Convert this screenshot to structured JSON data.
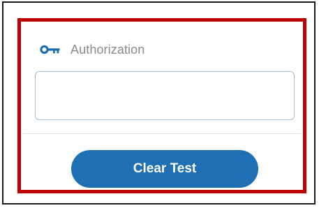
{
  "auth": {
    "label": "Authorization",
    "icon": "key-icon",
    "value": "",
    "placeholder": ""
  },
  "actions": {
    "clear_label": "Clear Test"
  },
  "colors": {
    "highlight_border": "#c00000",
    "frame_border": "#1a1a1a",
    "accent": "#1e6fb3",
    "label_text": "#8a8a8a",
    "input_border": "#a6bfcf"
  }
}
